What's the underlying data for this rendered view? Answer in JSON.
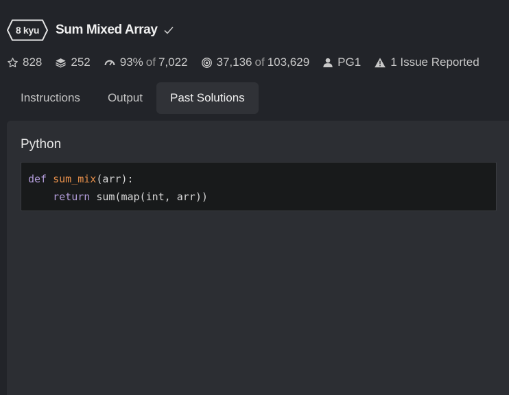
{
  "kata": {
    "rank": "8 kyu",
    "title": "Sum Mixed Array"
  },
  "stats": {
    "stars": "828",
    "collections": "252",
    "satisfaction": "93%",
    "satisfaction_of": "of",
    "satisfaction_votes": "7,022",
    "completed": "37,136",
    "completed_of": "of",
    "attempts": "103,629",
    "author": "PG1",
    "issues": "1 Issue Reported"
  },
  "tabs": [
    {
      "label": "Instructions"
    },
    {
      "label": "Output"
    },
    {
      "label": "Past Solutions",
      "active": true
    }
  ],
  "solution": {
    "language": "Python",
    "code": {
      "kw_def": "def",
      "fn_name": "sum_mix",
      "params": "(arr):",
      "indent": "    ",
      "kw_return": "return",
      "body": " sum(map(int, arr))"
    }
  },
  "colors": {
    "background": "#222429",
    "panel": "#2c2e33",
    "code_bg": "#181a1b",
    "keyword": "#b39ddb",
    "function": "#e8904b"
  }
}
